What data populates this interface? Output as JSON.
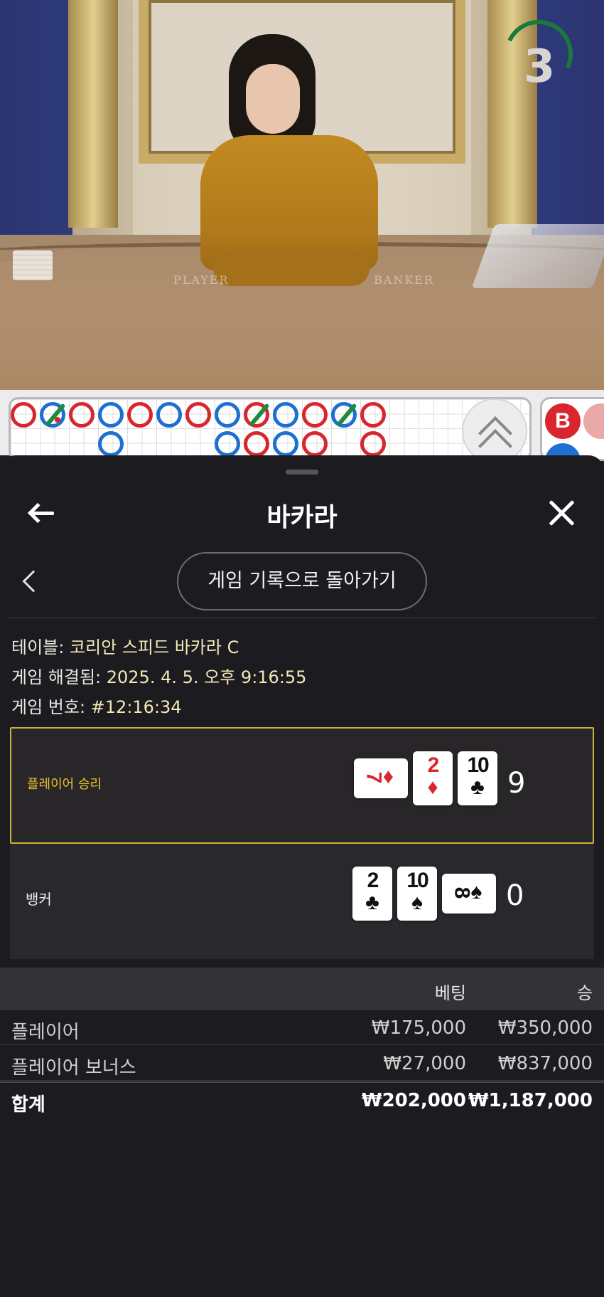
{
  "video": {
    "table_labels": [
      "PLAYER",
      "BANKER"
    ],
    "countdown": "3"
  },
  "road": {
    "beads_row1": [
      "r",
      "b-slash",
      "r",
      "b",
      "r",
      "b",
      "r",
      "b",
      "r-slash",
      "b",
      "r",
      "b-slash",
      "r"
    ],
    "beads_row2": [
      "",
      "",
      "",
      "b",
      "",
      "",
      "",
      "b",
      "r",
      "b",
      "r",
      "",
      "r"
    ],
    "side_label": "B"
  },
  "sheet": {
    "title": "바카라",
    "history_button": "게임 기록으로 돌아가기"
  },
  "game": {
    "table_label": "테이블: ",
    "table_value": "코리안 스피드 바카라 C",
    "resolved_label": "게임 해결됨: ",
    "resolved_value": "2025. 4. 5. 오후 9:16:55",
    "number_label": "게임 번호: ",
    "number_value": "#12:16:34"
  },
  "result": {
    "player_label": "플레이어 승리",
    "player_score": "9",
    "player_cards": [
      {
        "rank": "7",
        "suit": "♦",
        "color": "red",
        "sideways": true
      },
      {
        "rank": "2",
        "suit": "♦",
        "color": "red",
        "sideways": false
      },
      {
        "rank": "10",
        "suit": "♣",
        "color": "black",
        "sideways": false
      }
    ],
    "banker_label": "뱅커",
    "banker_score": "0",
    "banker_cards": [
      {
        "rank": "2",
        "suit": "♣",
        "color": "black",
        "sideways": false
      },
      {
        "rank": "10",
        "suit": "♠",
        "color": "black",
        "sideways": false
      },
      {
        "rank": "8",
        "suit": "♠",
        "color": "black",
        "sideways": true
      }
    ]
  },
  "bets": {
    "header_bet": "베팅",
    "header_win": "승",
    "rows": [
      {
        "name": "플레이어",
        "bet": "₩175,000",
        "win": "₩350,000"
      },
      {
        "name": "플레이어 보너스",
        "bet": "₩27,000",
        "win": "₩837,000"
      }
    ],
    "total": {
      "name": "합계",
      "bet": "₩202,000",
      "win": "₩1,187,000"
    }
  },
  "colors": {
    "accent_gold": "#c9b23a",
    "player_win_text": "#e8c32a",
    "sheet_bg": "#1c1b1f",
    "red_suit": "#d9262e",
    "blue_bead": "#1d6fd1"
  }
}
